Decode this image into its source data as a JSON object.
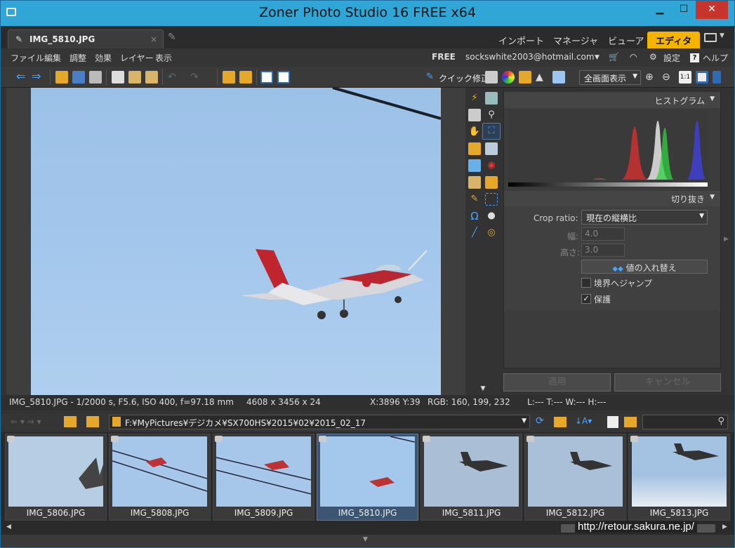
{
  "window": {
    "title": "Zoner Photo Studio 16 FREE x64"
  },
  "tabs": {
    "doc": "IMG_5810.JPG",
    "close": "×"
  },
  "modes": [
    {
      "label": "インポート"
    },
    {
      "label": "マネージャ"
    },
    {
      "label": "ビューア"
    },
    {
      "label": "エディタ"
    }
  ],
  "menu": {
    "items": [
      "ファイル",
      "編集",
      "調整",
      "効果",
      "レイヤー",
      "表示"
    ],
    "free": "FREE",
    "email": "sockswhite2003@hotmail.com",
    "settings": "設定",
    "help": "ヘルプ"
  },
  "toolbar": {
    "quick_fix": "クイック修正",
    "view_mode": "全画面表示"
  },
  "panel": {
    "histogram_title": "ヒストグラム",
    "crop_title": "切り抜き",
    "crop_ratio_label": "Crop ratio:",
    "crop_ratio_value": "現在の縦横比",
    "width_label": "幅:",
    "width_value": "4.0",
    "height_label": "高さ:",
    "height_value": "3.0",
    "swap_button": "値の入れ替え",
    "jump_label": "境界へジャンプ",
    "jump_checked": false,
    "protect_label": "保護",
    "protect_checked": true,
    "apply": "適用",
    "cancel": "キャンセル"
  },
  "status": {
    "info": "IMG_5810.JPG - 1/2000 s, F5.6, ISO 400, f=97.18 mm",
    "dims": "4608 x 3456 x 24",
    "coords": "X:3896 Y:39",
    "rgb": "RGB: 160, 199, 232",
    "lab": "L:---  T:---  W:---  H:---"
  },
  "path": "F:¥MyPictures¥デジカメ¥SX700HS¥2015¥02¥2015_02_17",
  "thumbnails": [
    {
      "name": "IMG_5806.JPG",
      "selected": false
    },
    {
      "name": "IMG_5808.JPG",
      "selected": false
    },
    {
      "name": "IMG_5809.JPG",
      "selected": false
    },
    {
      "name": "IMG_5810.JPG",
      "selected": true
    },
    {
      "name": "IMG_5811.JPG",
      "selected": false
    },
    {
      "name": "IMG_5812.JPG",
      "selected": false
    },
    {
      "name": "IMG_5813.JPG",
      "selected": false
    }
  ],
  "watermark": "http://retour.sakura.ne.jp/",
  "colors": {
    "accent": "#f5b400",
    "titlebar": "#2fa6d6",
    "sky": "#a0c4ea"
  }
}
